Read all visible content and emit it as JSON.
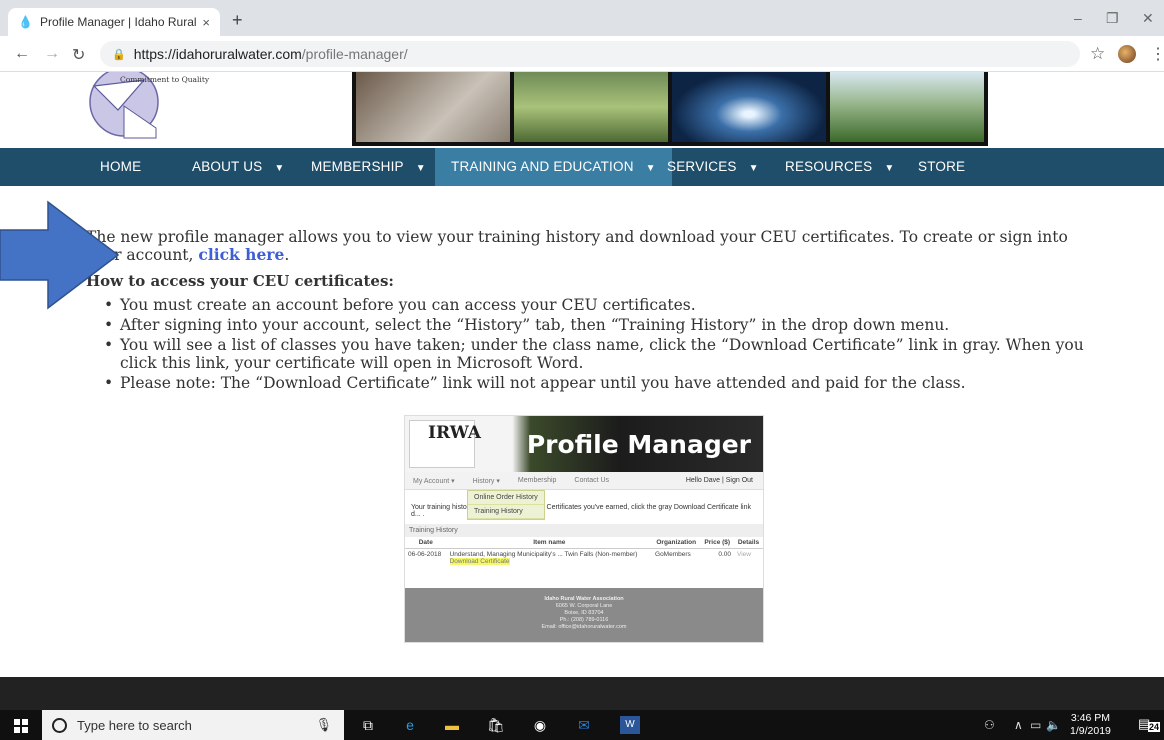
{
  "browser": {
    "tab_title": "Profile Manager | Idaho Rural Wa",
    "tab_close": "×",
    "new_tab": "+",
    "url_host": "https://idahoruralwater.com",
    "url_path": "/profile-manager/",
    "win_minimize": "–",
    "win_restore": "❐",
    "win_close": "✕"
  },
  "logo": {
    "tagline": "Commitment to Quality"
  },
  "nav": {
    "items": [
      {
        "label": "HOME",
        "has_caret": false
      },
      {
        "label": "ABOUT US",
        "has_caret": true
      },
      {
        "label": "MEMBERSHIP",
        "has_caret": true
      },
      {
        "label": "TRAINING AND EDUCATION",
        "has_caret": true,
        "active": true
      },
      {
        "label": "SERVICES",
        "has_caret": true
      },
      {
        "label": "RESOURCES",
        "has_caret": true
      },
      {
        "label": "STORE",
        "has_caret": false
      }
    ],
    "caret": "▼"
  },
  "content": {
    "intro": "The new profile manager allows you to view your training history and download your CEU certificates.  To create or sign into your account, ",
    "link": "click here",
    "intro_end": ".",
    "heading": "How to access your CEU certificates:",
    "bullets": [
      "You must create an account before you can access your CEU certificates.",
      "After signing into your account, select the “History” tab, then “Training History” in the drop down menu.",
      "You will see a list of classes you have taken; under the class name, click the “Download Certificate” link in gray.  When you click this link, your certificate will open in Microsoft Word.",
      "Please note: The “Download Certificate” link will not appear until you have attended and paid for the class."
    ]
  },
  "profile_manager_image": {
    "logo_text": "IRWA",
    "title": "Profile Manager",
    "menu": [
      "My Account ▾",
      "History ▾",
      "Membership",
      "Contact Us"
    ],
    "hello": "Hello Dave | Sign Out",
    "dropdown": [
      "Online Order History",
      "Training History"
    ],
    "text": "Your training history ... d copies of the CEU Certificates you've earned, click the gray Download Certificate link d... .",
    "section": "Training History",
    "columns": [
      "Date",
      "Item name",
      "Organization",
      "Price ($)",
      "Details"
    ],
    "row": {
      "date": "06-06-2018",
      "item": "Understand, Managing Municipality's ... Twin Falls (Non-member)",
      "download": "Download Certificate",
      "org": "GoMembers",
      "price": "0.00",
      "details": "View"
    },
    "footer": [
      "Idaho Rural Water Association",
      "6065 W. Corporal Lane",
      "Boise, ID 83704",
      "Ph.: (208) 789-0116",
      "Email: office@idahoruralwater.com"
    ]
  },
  "taskbar": {
    "search_placeholder": "Type here to search",
    "time": "3:46 PM",
    "date": "1/9/2019",
    "notification_count": "24"
  }
}
